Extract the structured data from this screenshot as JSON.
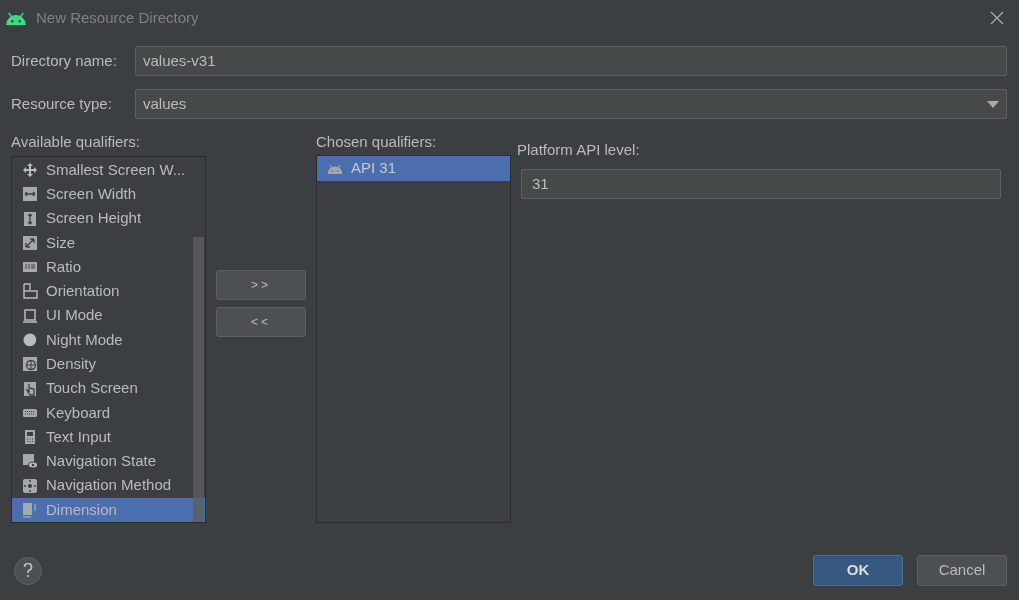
{
  "window": {
    "title": "New Resource Directory"
  },
  "directory_name": {
    "label": "Directory name:",
    "value": "values-v31"
  },
  "resource_type": {
    "label": "Resource type:",
    "value": "values"
  },
  "available_qualifiers": {
    "label": "Available qualifiers:",
    "items": [
      {
        "label": "Smallest Screen W...",
        "selected": false
      },
      {
        "label": "Screen Width",
        "selected": false
      },
      {
        "label": "Screen Height",
        "selected": false
      },
      {
        "label": "Size",
        "selected": false
      },
      {
        "label": "Ratio",
        "selected": false
      },
      {
        "label": "Orientation",
        "selected": false
      },
      {
        "label": "UI Mode",
        "selected": false
      },
      {
        "label": "Night Mode",
        "selected": false
      },
      {
        "label": "Density",
        "selected": false
      },
      {
        "label": "Touch Screen",
        "selected": false
      },
      {
        "label": "Keyboard",
        "selected": false
      },
      {
        "label": "Text Input",
        "selected": false
      },
      {
        "label": "Navigation State",
        "selected": false
      },
      {
        "label": "Navigation Method",
        "selected": false
      },
      {
        "label": "Dimension",
        "selected": true
      }
    ]
  },
  "move_buttons": [
    ">>",
    "<<"
  ],
  "chosen_qualifiers": {
    "label": "Chosen qualifiers:",
    "items": [
      {
        "label": "API 31",
        "selected": true
      }
    ]
  },
  "platform_api_level": {
    "label": "Platform API level:",
    "value": "31"
  },
  "buttons": {
    "ok": "OK",
    "cancel": "Cancel"
  }
}
